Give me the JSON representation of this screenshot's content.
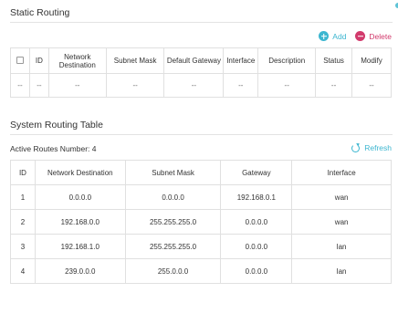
{
  "static_routing": {
    "title": "Static Routing",
    "add_label": "Add",
    "delete_label": "Delete",
    "columns": [
      "ID",
      "Network Destination",
      "Subnet Mask",
      "Default Gateway",
      "Interface",
      "Description",
      "Status",
      "Modify"
    ],
    "empty_row": [
      "--",
      "--",
      "--",
      "--",
      "--",
      "--",
      "--",
      "--",
      "--"
    ]
  },
  "system_routing": {
    "title": "System Routing Table",
    "active_routes_label": "Active Routes Number: 4",
    "refresh_label": "Refresh",
    "columns": [
      "ID",
      "Network Destination",
      "Subnet Mask",
      "Gateway",
      "Interface"
    ],
    "rows": [
      [
        "1",
        "0.0.0.0",
        "0.0.0.0",
        "192.168.0.1",
        "wan"
      ],
      [
        "2",
        "192.168.0.0",
        "255.255.255.0",
        "0.0.0.0",
        "wan"
      ],
      [
        "3",
        "192.168.1.0",
        "255.255.255.0",
        "0.0.0.0",
        "lan"
      ],
      [
        "4",
        "239.0.0.0",
        "255.0.0.0",
        "0.0.0.0",
        "lan"
      ]
    ]
  },
  "colors": {
    "accent": "#3cb6d0",
    "delete": "#d23a6c",
    "border": "#e0e0e0"
  },
  "icons": [
    "add-icon",
    "delete-icon",
    "refresh-icon",
    "checkbox-icon"
  ]
}
